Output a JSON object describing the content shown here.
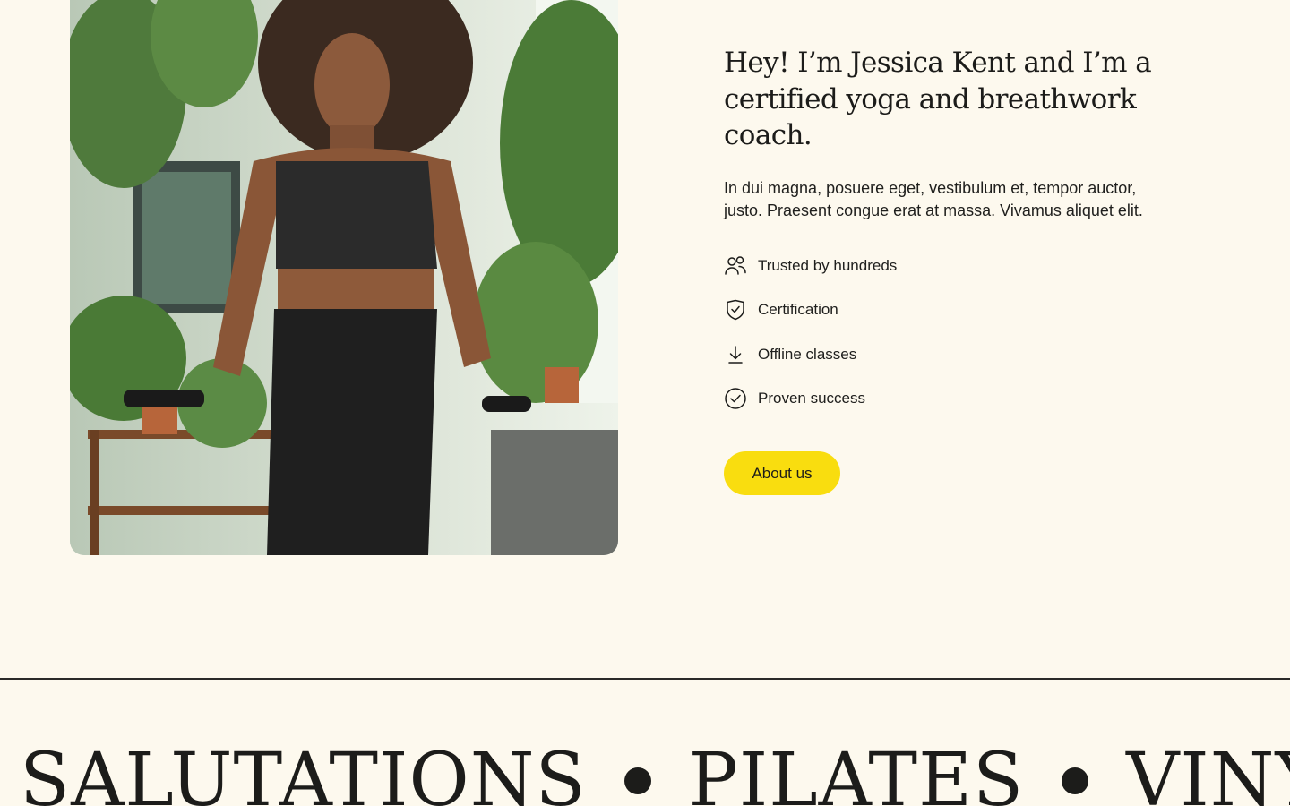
{
  "about": {
    "heading": "Hey! I’m Jessica Kent and I’m a certified yoga and breathwork coach.",
    "lead": "In dui magna, posuere eget, vestibulum et, tempor auctor, justo. Praesent congue erat at massa. Vivamus aliquet elit.",
    "features": [
      {
        "label": "Trusted by hundreds",
        "icon": "users-icon"
      },
      {
        "label": "Certification",
        "icon": "shield-check-icon"
      },
      {
        "label": "Offline classes",
        "icon": "download-icon"
      },
      {
        "label": "Proven success",
        "icon": "check-circle-icon"
      }
    ],
    "button_label": "About us"
  },
  "marquee": {
    "words": [
      "SALUTATIONS",
      "PILATES",
      "VINYASA"
    ]
  },
  "colors": {
    "background": "#fdf9ee",
    "accent": "#f9dd0f",
    "text": "#1c1c1a"
  }
}
